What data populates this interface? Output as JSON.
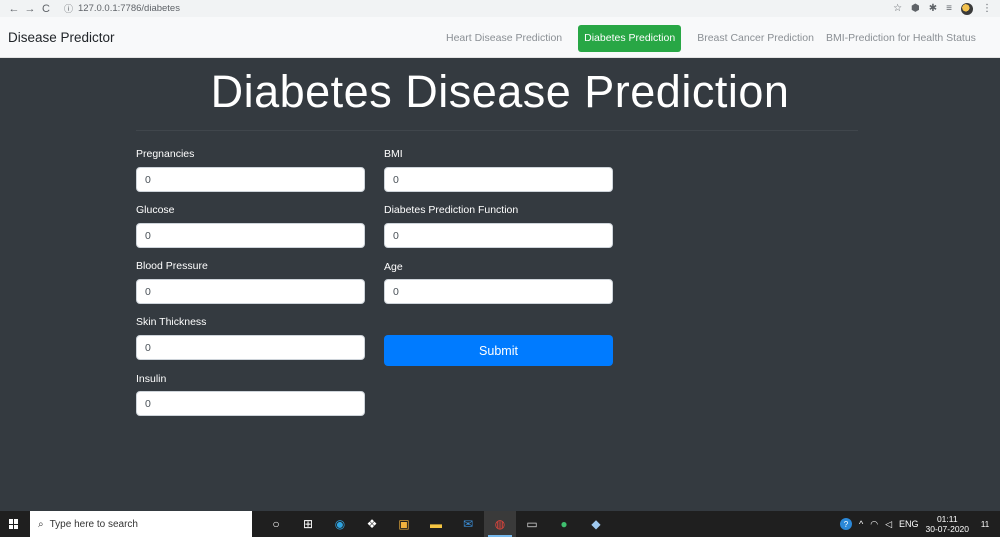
{
  "browser": {
    "url": "127.0.0.1:7786/diabetes",
    "back_icon": "←",
    "forward_icon": "→",
    "reload_icon": "C",
    "info_icon": "ⓘ",
    "star_icon": "☆",
    "ext1_icon": "⬢",
    "ext2_icon": "✱",
    "media_icon": "≡",
    "menu_icon": "⋮"
  },
  "navbar": {
    "brand": "Disease Predictor",
    "links": [
      {
        "label": "Heart Disease Prediction",
        "active": false
      },
      {
        "label": "Diabetes Prediction",
        "active": true
      },
      {
        "label": "Breast Cancer Prediction",
        "active": false
      },
      {
        "label": "BMI-Prediction for Health Status",
        "active": false
      }
    ]
  },
  "page": {
    "title": "Diabetes Disease Prediction"
  },
  "form": {
    "left": [
      {
        "label": "Pregnancies",
        "value": "0"
      },
      {
        "label": "Glucose",
        "value": "0"
      },
      {
        "label": "Blood Pressure",
        "value": "0"
      },
      {
        "label": "Skin Thickness",
        "value": "0"
      },
      {
        "label": "Insulin",
        "value": "0"
      }
    ],
    "right": [
      {
        "label": "BMI",
        "value": "0"
      },
      {
        "label": "Diabetes Prediction Function",
        "value": "0"
      },
      {
        "label": "Age",
        "value": "0"
      }
    ],
    "submit_label": "Submit"
  },
  "taskbar": {
    "search_placeholder": "Type here to search",
    "search_icon": "⌕",
    "task_view_icon": "○",
    "widgets_icon": "⊞",
    "apps": [
      {
        "name": "edge",
        "glyph": "◉",
        "color": "#2fa3e0"
      },
      {
        "name": "dropbox",
        "glyph": "❖",
        "color": "#ffffff"
      },
      {
        "name": "store",
        "glyph": "▣",
        "color": "#f3b33d"
      },
      {
        "name": "file-explorer",
        "glyph": "▬",
        "color": "#f5c542"
      },
      {
        "name": "mail",
        "glyph": "✉",
        "color": "#3b8fd9"
      },
      {
        "name": "chrome",
        "glyph": "◍",
        "color": "#e8453c"
      },
      {
        "name": "terminal",
        "glyph": "▭",
        "color": "#d9d9d9"
      },
      {
        "name": "app-green",
        "glyph": "●",
        "color": "#3fbf6f"
      },
      {
        "name": "app-blue",
        "glyph": "◆",
        "color": "#9fc9ef"
      }
    ],
    "tray": {
      "help_icon": "?",
      "caret_icon": "^",
      "wifi_icon": "◠",
      "volume_icon": "◁",
      "language": "ENG",
      "time": "01:11",
      "date": "30-07-2020",
      "notifications_count": "11"
    }
  }
}
